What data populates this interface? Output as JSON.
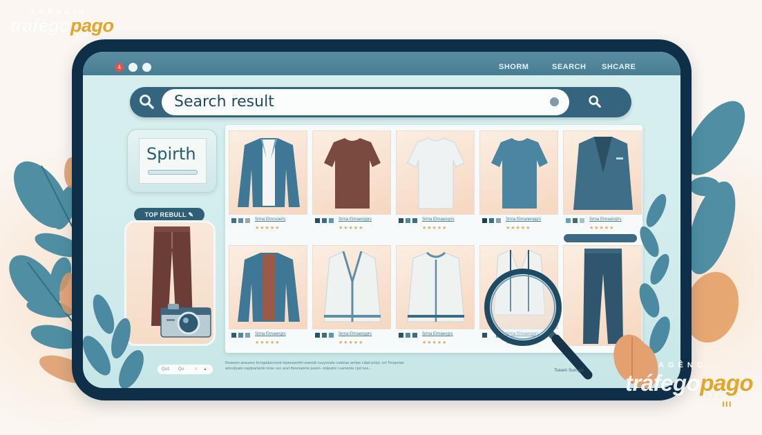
{
  "brand": {
    "logo_top_left": {
      "agencia": "AGÊNCIA",
      "trafego": "tráfego",
      "pago": "pago"
    },
    "logo_bottom_right": {
      "agencia": "AGÊNC",
      "trafego": "tráfego",
      "pago": "pago"
    },
    "accent_color": "#e2a62a"
  },
  "browser": {
    "window_controls": [
      "close",
      "minimize",
      "maximize"
    ],
    "close_badge": "4",
    "nav_links": [
      "SHORM",
      "SEARCH",
      "SHCARE"
    ]
  },
  "search": {
    "value": "Search result",
    "left_icon": "search-icon",
    "right_icon": "search-icon",
    "mic_icon": "voice-dot-icon"
  },
  "sidebar": {
    "query_card_text": "Spirth",
    "top_result_label": "TOP REBULL",
    "top_result_icon": "pencil-icon",
    "hero_item": "brown trousers",
    "camera_icon": "camera-icon"
  },
  "results": [
    {
      "item": "blue blazer over white tee",
      "title": "Srma Elmrsoerls",
      "rating": "★★★★★"
    },
    {
      "item": "brown t-shirt",
      "title": "Srma Elmaengqrs",
      "rating": "★★★★★"
    },
    {
      "item": "white t-shirt",
      "title": "Srma Elmaenqrrs",
      "rating": "★★★★★"
    },
    {
      "item": "blue t-shirt",
      "title": "Srma Elmanengqrs",
      "rating": "★★★★★"
    },
    {
      "item": "blue suit jacket",
      "title": "Srma Elmaenqrrs",
      "rating": "★★★★★"
    },
    {
      "item": "blue blazer over brown tee",
      "title": "Srma Elmaengrs",
      "rating": "★★★★★"
    },
    {
      "item": "white v-neck cardigan",
      "title": "Srma Elmaengqrs",
      "rating": "★★★★★"
    },
    {
      "item": "white crew cardigan",
      "title": "Srma Elmaengrs",
      "rating": "★★★★★"
    },
    {
      "item": "white shirt under magnifier",
      "title": "Srma Elmaengqrs",
      "rating": "★★★★★"
    },
    {
      "item": "navy trousers",
      "title": "",
      "rating": ""
    }
  ],
  "footer": {
    "pager": [
      "Qu1",
      "Qu",
      "≡",
      "▲"
    ],
    "description": "Reaeam ansuees forngadacmunt mpeeasmthi wanedt cuuyneale cueleae amtae cdad prdyt, cnl Tinapeian artoutiyate naptpartanle nose ovc acet thevnanme paren- oniputre t samente cpd nes...",
    "note": "Tseam Sumgsi",
    "magnifier_icon": "magnifier-icon"
  }
}
